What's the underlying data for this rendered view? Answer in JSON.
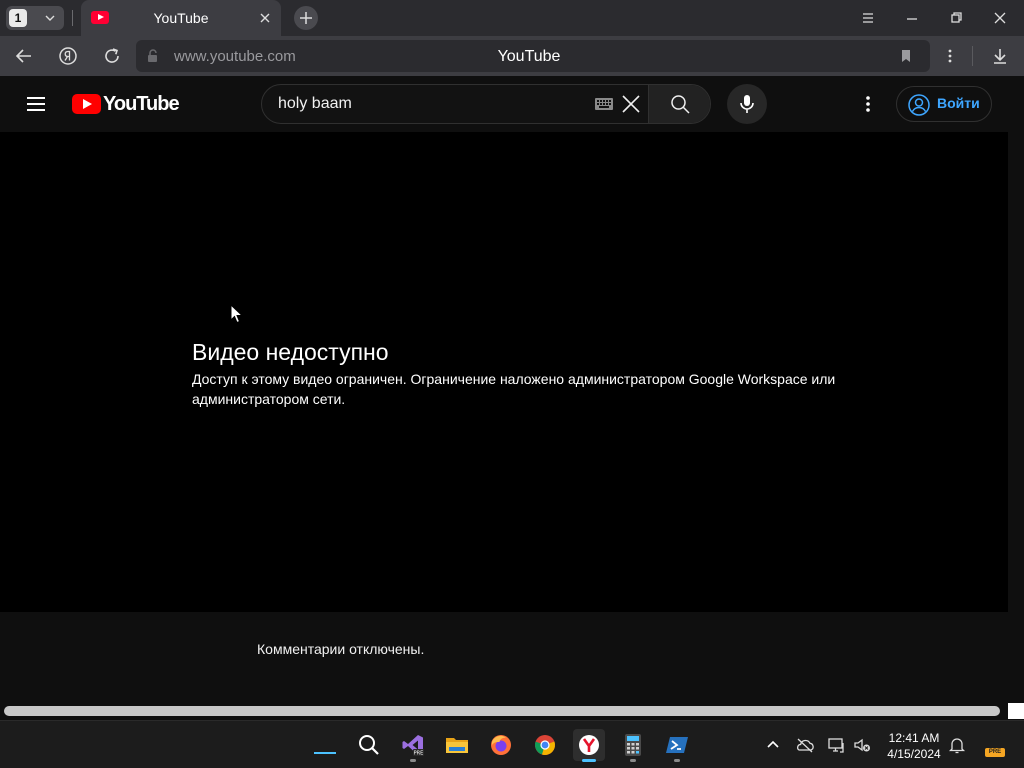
{
  "browser": {
    "tab_count": "1",
    "tab_title": "YouTube",
    "url": "www.youtube.com",
    "page_title": "YouTube"
  },
  "youtube": {
    "logo_text": "YouTube",
    "search_query": "holy baam",
    "signin_label": "Войти"
  },
  "player": {
    "error_title": "Видео недоступно",
    "error_message": "Доступ к этому видео ограничен. Ограничение наложено администратором Google Workspace или администратором сети."
  },
  "comments": {
    "status": "Комментарии отключены."
  },
  "taskbar": {
    "time": "12:41 AM",
    "date": "4/15/2024",
    "apps": [
      "search",
      "visual-studio-preview",
      "file-explorer",
      "firefox",
      "chrome",
      "yandex-browser",
      "calculator",
      "powershell"
    ],
    "active_app": "yandex-browser",
    "pre_badge": "PRE"
  },
  "colors": {
    "youtube_red": "#ff0000",
    "link_blue": "#3ea6ff",
    "taskbar_accent": "#4cc2ff"
  }
}
